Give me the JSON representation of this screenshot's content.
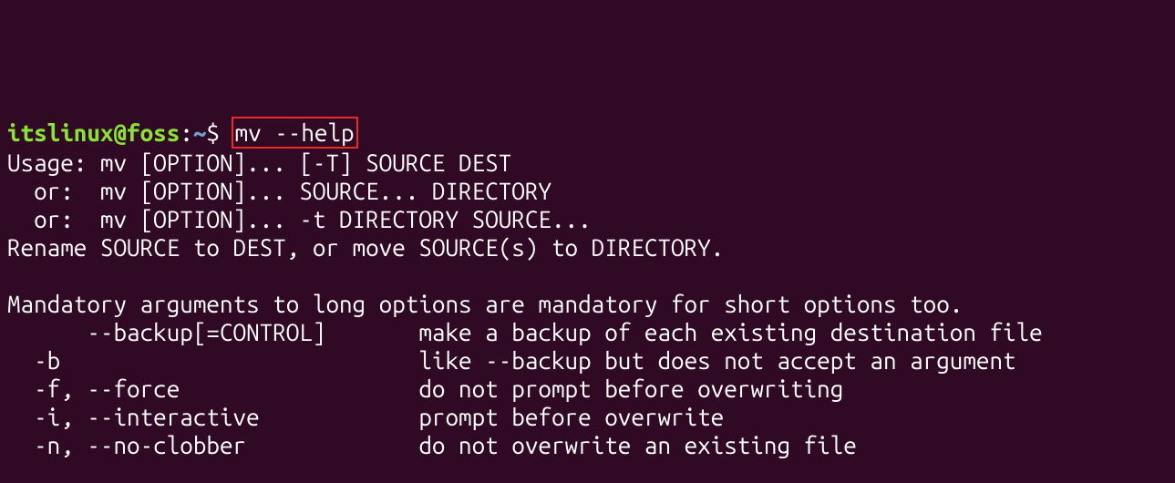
{
  "prompt": {
    "user": "itslinux@foss",
    "colon": ":",
    "path": "~",
    "dollar": "$ "
  },
  "command": "mv --help",
  "output": "Usage: mv [OPTION]... [-T] SOURCE DEST\n  or:  mv [OPTION]... SOURCE... DIRECTORY\n  or:  mv [OPTION]... -t DIRECTORY SOURCE...\nRename SOURCE to DEST, or move SOURCE(s) to DIRECTORY.\n\nMandatory arguments to long options are mandatory for short options too.\n      --backup[=CONTROL]       make a backup of each existing destination file\n  -b                           like --backup but does not accept an argument\n  -f, --force                  do not prompt before overwriting\n  -i, --interactive            prompt before overwrite\n  -n, --no-clobber             do not overwrite an existing file"
}
